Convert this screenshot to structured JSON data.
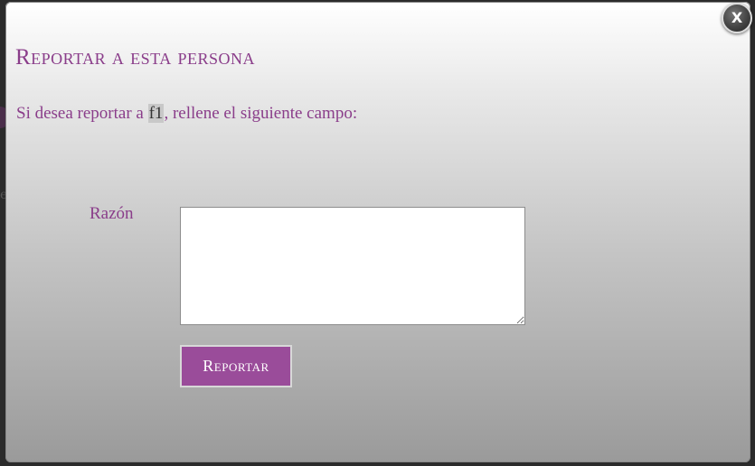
{
  "dialog": {
    "close_label": "X",
    "title": "Reportar a esta persona",
    "instruction_prefix": "Si desea reportar a ",
    "username": "f1",
    "instruction_suffix": ", rellene el siguiente campo:",
    "reason_label": "Razón",
    "reason_value": "",
    "report_button_label": "Reportar"
  },
  "colors": {
    "accent_text": "#8a3d8a",
    "button_bg": "#9a4c9a"
  }
}
